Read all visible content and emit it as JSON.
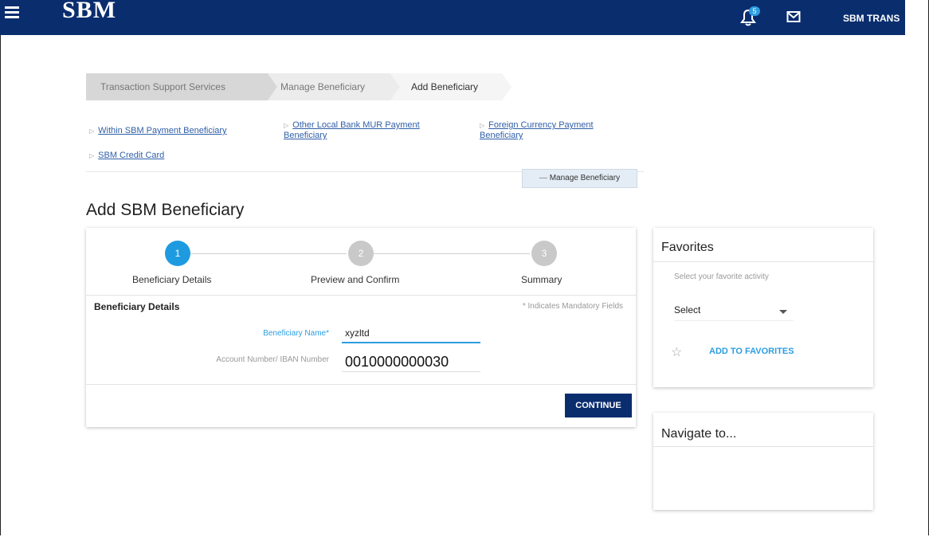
{
  "header": {
    "logo": "SBM",
    "notification_count": "5",
    "user_name": "SBM TRANS"
  },
  "breadcrumb": [
    "Transaction Support Services",
    "Manage Beneficiary",
    "Add Beneficiary"
  ],
  "beneficiary_links": {
    "within_sbm": "Within SBM Payment Beneficiary",
    "other_local_line1": "Other Local Bank MUR Payment",
    "other_local_line2": "Beneficiary",
    "foreign_line1": "Foreign Currency Payment",
    "foreign_line2": "Beneficiary",
    "credit_card": "SBM Credit Card",
    "manage_button": "Manage Beneficiary"
  },
  "page_title": "Add SBM Beneficiary",
  "stepper": {
    "steps": [
      {
        "number": "1",
        "label": "Beneficiary Details"
      },
      {
        "number": "2",
        "label": "Preview and Confirm"
      },
      {
        "number": "3",
        "label": "Summary"
      }
    ],
    "active_step": 1
  },
  "form": {
    "section_title": "Beneficiary Details",
    "mandatory_note": "* Indicates Mandatory Fields",
    "name_label": "Beneficiary Name*",
    "name_value": "xyzltd",
    "account_label": "Account Number/ IBAN Number",
    "account_value": "0010000000030",
    "continue_label": "CONTINUE"
  },
  "favorites": {
    "title": "Favorites",
    "hint": "Select your favorite activity",
    "select_value": "Select",
    "add_label": "ADD TO FAVORITES"
  },
  "navigate": {
    "title": "Navigate to..."
  },
  "colors": {
    "brand_navy": "#0a2d6e",
    "accent_blue": "#1e9be0"
  }
}
